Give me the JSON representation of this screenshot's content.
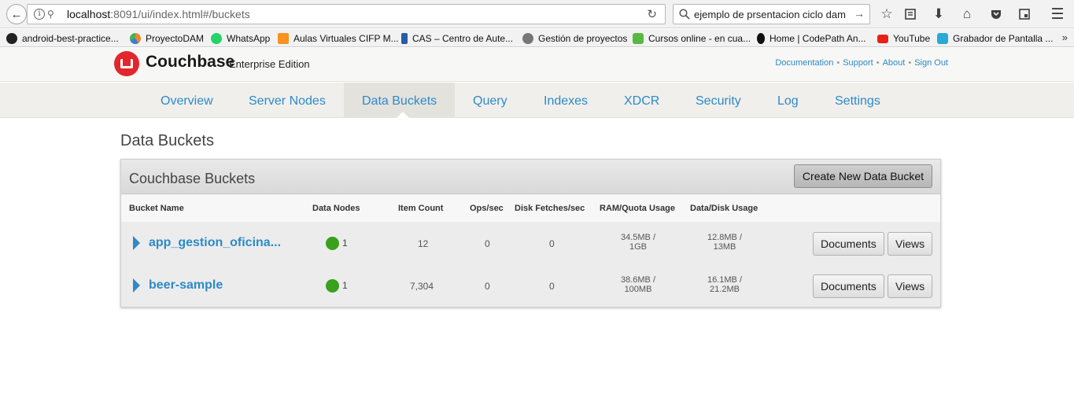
{
  "browser": {
    "url_host": "localhost",
    "url_path": ":8091/ui/index.html#/buckets",
    "search_text": "ejemplo de prsentacion ciclo dam",
    "bookmarks": [
      {
        "label": "android-best-practice...",
        "icon": "github-icon",
        "color": "#222222"
      },
      {
        "label": "ProyectoDAM",
        "icon": "pie-chart-icon",
        "color": "#e7892b"
      },
      {
        "label": "WhatsApp",
        "icon": "whatsapp-icon",
        "color": "#25d366"
      },
      {
        "label": "Aulas Virtuales CIFP M...",
        "icon": "moodle-icon",
        "color": "#f7931e"
      },
      {
        "label": "CAS – Centro de Aute...",
        "icon": "bottle-icon",
        "color": "#2a5aa8"
      },
      {
        "label": "Gestión de proyectos",
        "icon": "globe-icon",
        "color": "#777777"
      },
      {
        "label": "Cursos online - en cua...",
        "icon": "udemy-icon",
        "color": "#59b842"
      },
      {
        "label": "Home | CodePath An...",
        "icon": "codepath-icon",
        "color": "#111111"
      },
      {
        "label": "YouTube",
        "icon": "youtube-icon",
        "color": "#e62117"
      },
      {
        "label": "Grabador de Pantalla ...",
        "icon": "recorder-icon",
        "color": "#2aa9d6"
      }
    ],
    "bookmarks_more": "»"
  },
  "header": {
    "brand": "Couchbase",
    "edition": "Enterprise Edition",
    "links": [
      "Documentation",
      "Support",
      "About",
      "Sign Out"
    ],
    "brand_color": "#e2262b"
  },
  "nav": {
    "tabs": [
      "Overview",
      "Server Nodes",
      "Data Buckets",
      "Query",
      "Indexes",
      "XDCR",
      "Security",
      "Log",
      "Settings"
    ],
    "active": "Data Buckets"
  },
  "page": {
    "title": "Data Buckets",
    "panel_title": "Couchbase Buckets",
    "create_button": "Create New Data Bucket",
    "columns": [
      "Bucket Name",
      "Data Nodes",
      "Item Count",
      "Ops/sec",
      "Disk Fetches/sec",
      "RAM/Quota Usage",
      "Data/Disk Usage"
    ],
    "buckets": [
      {
        "name": "app_gestion_oficina...",
        "nodes": "1",
        "items": "12",
        "ops": "0",
        "fetches": "0",
        "ram_used": "34.5MB /",
        "ram_quota": "1GB",
        "disk_data": "12.8MB /",
        "disk_total": "13MB",
        "docs_label": "Documents",
        "views_label": "Views"
      },
      {
        "name": "beer-sample",
        "nodes": "1",
        "items": "7,304",
        "ops": "0",
        "fetches": "0",
        "ram_used": "38.6MB /",
        "ram_quota": "100MB",
        "disk_data": "16.1MB /",
        "disk_total": "21.2MB",
        "docs_label": "Documents",
        "views_label": "Views"
      }
    ]
  }
}
